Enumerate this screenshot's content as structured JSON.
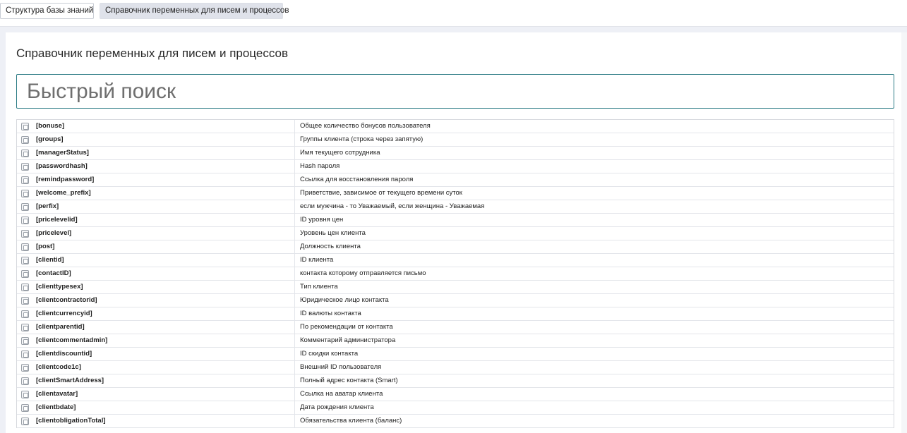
{
  "tabs": [
    {
      "label": "Структура базы знаний"
    },
    {
      "label": "Справочник переменных для писем и процессов"
    }
  ],
  "page": {
    "title": "Справочник переменных для писем и процессов"
  },
  "search": {
    "placeholder": "Быстрый поиск",
    "value": ""
  },
  "icons": {
    "row_icon": "copy-icon"
  },
  "rows": [
    {
      "var": "[bonuse]",
      "desc": "Общее количество бонусов пользователя"
    },
    {
      "var": "[groups]",
      "desc": "Группы клиента (строка через запятую)"
    },
    {
      "var": "[managerStatus]",
      "desc": "Имя текущего сотрудника"
    },
    {
      "var": "[passwordhash]",
      "desc": "Hash пароля"
    },
    {
      "var": "[remindpassword]",
      "desc": "Ссылка для восстановления пароля"
    },
    {
      "var": "[welcome_prefix]",
      "desc": "Приветствие, зависимое от текущего времени суток"
    },
    {
      "var": "[perfix]",
      "desc": "если мужчина - то Уважаемый, если женщина - Уважаемая"
    },
    {
      "var": "[pricelevelid]",
      "desc": "ID уровня цен"
    },
    {
      "var": "[pricelevel]",
      "desc": "Уровень цен клиента"
    },
    {
      "var": "[post]",
      "desc": "Должность клиента"
    },
    {
      "var": "[clientid]",
      "desc": "ID клиента"
    },
    {
      "var": "[contactID]",
      "desc": "контакта которому отправляется письмо"
    },
    {
      "var": "[clienttypesex]",
      "desc": "Тип клиента"
    },
    {
      "var": "[clientcontractorid]",
      "desc": "Юридическое лицо контакта"
    },
    {
      "var": "[clientcurrencyid]",
      "desc": "ID валюты контакта"
    },
    {
      "var": "[clientparentid]",
      "desc": "По рекомендации от контакта"
    },
    {
      "var": "[clientcommentadmin]",
      "desc": "Комментарий администратора"
    },
    {
      "var": "[clientdiscountid]",
      "desc": "ID скидки контакта"
    },
    {
      "var": "[clientcode1c]",
      "desc": "Внешний ID пользователя"
    },
    {
      "var": "[clientSmartAddress]",
      "desc": "Полный адрес контакта (Smart)"
    },
    {
      "var": "[clientavatar]",
      "desc": "Ссылка на аватар клиента"
    },
    {
      "var": "[clientbdate]",
      "desc": "Дата рождения клиента"
    },
    {
      "var": "[clientobligationTotal]",
      "desc": "Обязательства клиента (баланс)"
    }
  ]
}
